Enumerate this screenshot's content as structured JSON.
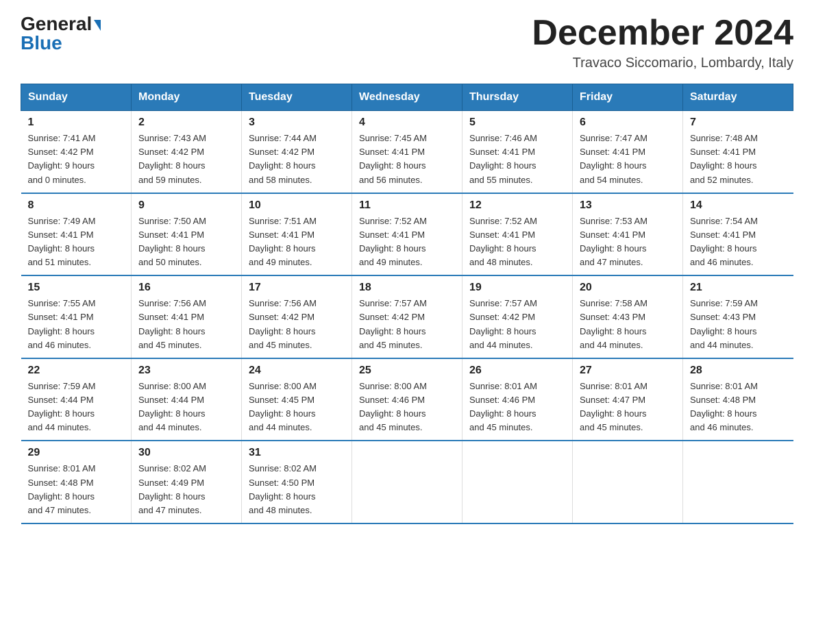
{
  "logo": {
    "part1": "General",
    "part2": "Blue"
  },
  "header": {
    "month": "December 2024",
    "location": "Travaco Siccomario, Lombardy, Italy"
  },
  "weekdays": [
    "Sunday",
    "Monday",
    "Tuesday",
    "Wednesday",
    "Thursday",
    "Friday",
    "Saturday"
  ],
  "weeks": [
    [
      {
        "day": "1",
        "sunrise": "7:41 AM",
        "sunset": "4:42 PM",
        "daylight": "9 hours and 0 minutes."
      },
      {
        "day": "2",
        "sunrise": "7:43 AM",
        "sunset": "4:42 PM",
        "daylight": "8 hours and 59 minutes."
      },
      {
        "day": "3",
        "sunrise": "7:44 AM",
        "sunset": "4:42 PM",
        "daylight": "8 hours and 58 minutes."
      },
      {
        "day": "4",
        "sunrise": "7:45 AM",
        "sunset": "4:41 PM",
        "daylight": "8 hours and 56 minutes."
      },
      {
        "day": "5",
        "sunrise": "7:46 AM",
        "sunset": "4:41 PM",
        "daylight": "8 hours and 55 minutes."
      },
      {
        "day": "6",
        "sunrise": "7:47 AM",
        "sunset": "4:41 PM",
        "daylight": "8 hours and 54 minutes."
      },
      {
        "day": "7",
        "sunrise": "7:48 AM",
        "sunset": "4:41 PM",
        "daylight": "8 hours and 52 minutes."
      }
    ],
    [
      {
        "day": "8",
        "sunrise": "7:49 AM",
        "sunset": "4:41 PM",
        "daylight": "8 hours and 51 minutes."
      },
      {
        "day": "9",
        "sunrise": "7:50 AM",
        "sunset": "4:41 PM",
        "daylight": "8 hours and 50 minutes."
      },
      {
        "day": "10",
        "sunrise": "7:51 AM",
        "sunset": "4:41 PM",
        "daylight": "8 hours and 49 minutes."
      },
      {
        "day": "11",
        "sunrise": "7:52 AM",
        "sunset": "4:41 PM",
        "daylight": "8 hours and 49 minutes."
      },
      {
        "day": "12",
        "sunrise": "7:52 AM",
        "sunset": "4:41 PM",
        "daylight": "8 hours and 48 minutes."
      },
      {
        "day": "13",
        "sunrise": "7:53 AM",
        "sunset": "4:41 PM",
        "daylight": "8 hours and 47 minutes."
      },
      {
        "day": "14",
        "sunrise": "7:54 AM",
        "sunset": "4:41 PM",
        "daylight": "8 hours and 46 minutes."
      }
    ],
    [
      {
        "day": "15",
        "sunrise": "7:55 AM",
        "sunset": "4:41 PM",
        "daylight": "8 hours and 46 minutes."
      },
      {
        "day": "16",
        "sunrise": "7:56 AM",
        "sunset": "4:41 PM",
        "daylight": "8 hours and 45 minutes."
      },
      {
        "day": "17",
        "sunrise": "7:56 AM",
        "sunset": "4:42 PM",
        "daylight": "8 hours and 45 minutes."
      },
      {
        "day": "18",
        "sunrise": "7:57 AM",
        "sunset": "4:42 PM",
        "daylight": "8 hours and 45 minutes."
      },
      {
        "day": "19",
        "sunrise": "7:57 AM",
        "sunset": "4:42 PM",
        "daylight": "8 hours and 44 minutes."
      },
      {
        "day": "20",
        "sunrise": "7:58 AM",
        "sunset": "4:43 PM",
        "daylight": "8 hours and 44 minutes."
      },
      {
        "day": "21",
        "sunrise": "7:59 AM",
        "sunset": "4:43 PM",
        "daylight": "8 hours and 44 minutes."
      }
    ],
    [
      {
        "day": "22",
        "sunrise": "7:59 AM",
        "sunset": "4:44 PM",
        "daylight": "8 hours and 44 minutes."
      },
      {
        "day": "23",
        "sunrise": "8:00 AM",
        "sunset": "4:44 PM",
        "daylight": "8 hours and 44 minutes."
      },
      {
        "day": "24",
        "sunrise": "8:00 AM",
        "sunset": "4:45 PM",
        "daylight": "8 hours and 44 minutes."
      },
      {
        "day": "25",
        "sunrise": "8:00 AM",
        "sunset": "4:46 PM",
        "daylight": "8 hours and 45 minutes."
      },
      {
        "day": "26",
        "sunrise": "8:01 AM",
        "sunset": "4:46 PM",
        "daylight": "8 hours and 45 minutes."
      },
      {
        "day": "27",
        "sunrise": "8:01 AM",
        "sunset": "4:47 PM",
        "daylight": "8 hours and 45 minutes."
      },
      {
        "day": "28",
        "sunrise": "8:01 AM",
        "sunset": "4:48 PM",
        "daylight": "8 hours and 46 minutes."
      }
    ],
    [
      {
        "day": "29",
        "sunrise": "8:01 AM",
        "sunset": "4:48 PM",
        "daylight": "8 hours and 47 minutes."
      },
      {
        "day": "30",
        "sunrise": "8:02 AM",
        "sunset": "4:49 PM",
        "daylight": "8 hours and 47 minutes."
      },
      {
        "day": "31",
        "sunrise": "8:02 AM",
        "sunset": "4:50 PM",
        "daylight": "8 hours and 48 minutes."
      },
      null,
      null,
      null,
      null
    ]
  ],
  "labels": {
    "sunrise": "Sunrise:",
    "sunset": "Sunset:",
    "daylight": "Daylight:"
  }
}
